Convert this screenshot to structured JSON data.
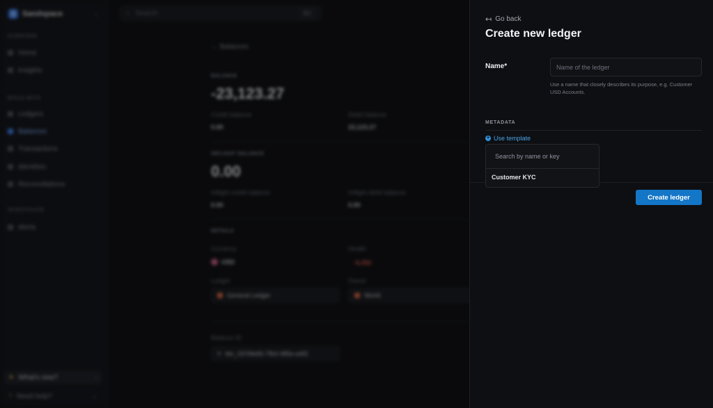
{
  "colors": {
    "accent": "#1476c7",
    "link": "#4aa3e6",
    "negative": "#e05b4a",
    "background": "#0b0c0e"
  },
  "background_app": {
    "workspace": {
      "logo_letter": "S",
      "name": "Sandspace"
    },
    "search": {
      "placeholder": "Search",
      "shortcut": "⌘K"
    },
    "sidebar": {
      "sections": [
        {
          "title": "OVERVIEW",
          "items": [
            "Home",
            "Insights"
          ]
        },
        {
          "title": "BUILD WITH",
          "items": [
            "Ledgers",
            "Balances",
            "Transactions",
            "Identities",
            "Reconciliations"
          ]
        },
        {
          "title": "INVESTIGATE",
          "items": [
            "Alerts"
          ]
        }
      ],
      "active_item": "Balances",
      "whats_new": "What's new?",
      "need_help": "Need help?"
    },
    "balance": {
      "back_label": "Balances",
      "balance_label": "BALANCE",
      "balance_value": "-23,123.27",
      "credit_label": "Credit balance",
      "credit_value": "0.00",
      "debit_label": "Debit balance",
      "debit_value": "23,123.27",
      "inflight_label": "INFLIGHT BALANCE",
      "inflight_value": "0.00",
      "inflight_credit_label": "Inflight credit balance",
      "inflight_credit_value": "0.00",
      "inflight_debit_label": "Inflight debit balance",
      "inflight_debit_value": "0.00",
      "details_label": "DETAILS",
      "currency_label": "Currency",
      "currency_value": "USD",
      "health_label": "Health",
      "health_value": "-9,352",
      "ledger_label": "Ledger",
      "ledger_value": "General Ledger",
      "owner_label": "Owner",
      "owner_value": "World",
      "balance_id_label": "Balance ID",
      "balance_id_value": "bln_0376fe65-7fb3-485e-a4f2"
    }
  },
  "drawer": {
    "go_back": "Go back",
    "title": "Create new ledger",
    "name_label": "Name*",
    "name_placeholder": "Name of the ledger",
    "name_value": "",
    "hint": "Use a name that closely describes its purpose, e.g. Customer USD Accounts.",
    "metadata_label": "METADATA",
    "use_template": "Use template",
    "template_search_placeholder": "Search by name or key",
    "template_options": [
      "Customer KYC"
    ],
    "create_button": "Create ledger"
  }
}
